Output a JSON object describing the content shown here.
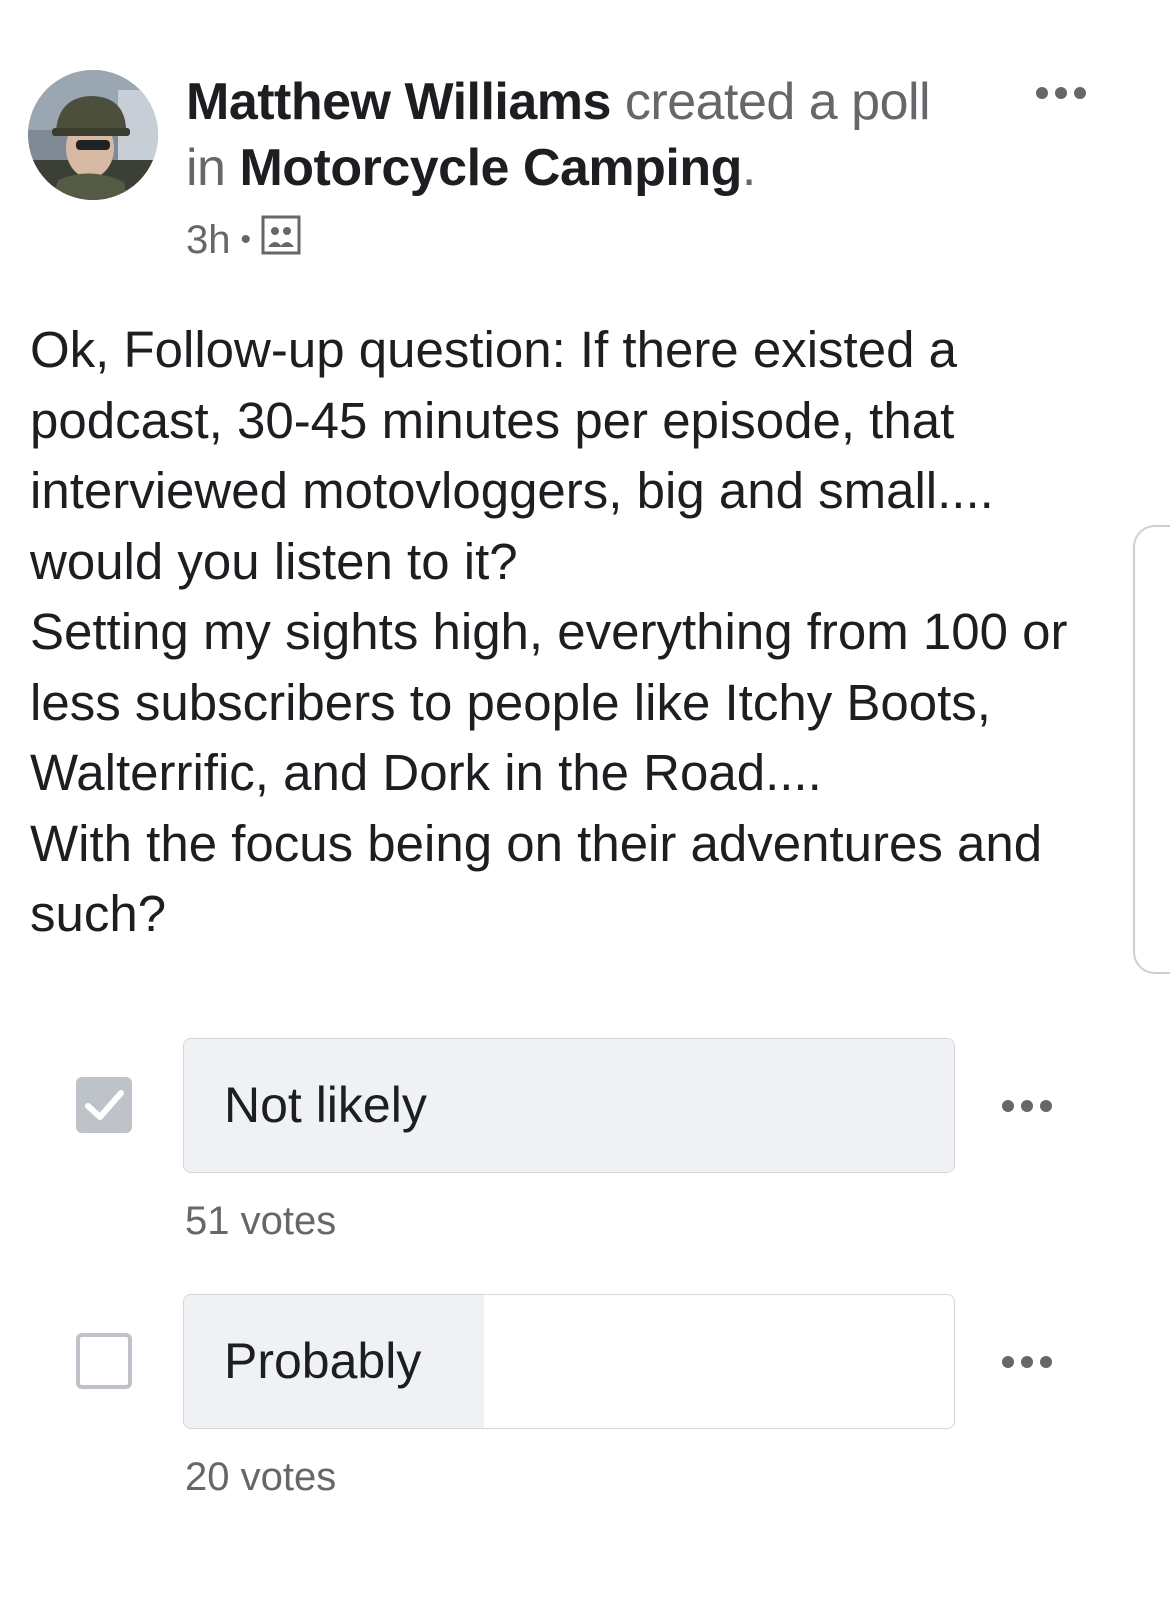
{
  "post": {
    "author": "Matthew Williams",
    "action": "created a poll",
    "in_word": "in",
    "group": "Motorcycle Camping",
    "group_suffix": ".",
    "time": "3h",
    "time_separator": "•",
    "audience_icon": "group-members-icon",
    "more_icon": "more-options-icon",
    "body": "Ok, Follow-up question: If there existed a podcast, 30-45 minutes per episode, that interviewed motovloggers, big and small.... would you listen to it?\nSetting my sights high, everything from 100 or less subscribers to people like Itchy Boots, Walterrific, and Dork in the Road....\nWith the focus being on their adventures and such?"
  },
  "poll": {
    "options": [
      {
        "label": "Not likely",
        "votes_text": "51 votes",
        "votes": 51,
        "checked": true,
        "share": 1.0
      },
      {
        "label": "Probably",
        "votes_text": "20 votes",
        "votes": 20,
        "checked": false,
        "share": 0.39
      }
    ]
  },
  "colors": {
    "text": "#1c1e21",
    "muted": "#65676b",
    "checkbox": "#bec3c9",
    "result_fill": "#f0f1f4",
    "border": "#d3d6db"
  }
}
